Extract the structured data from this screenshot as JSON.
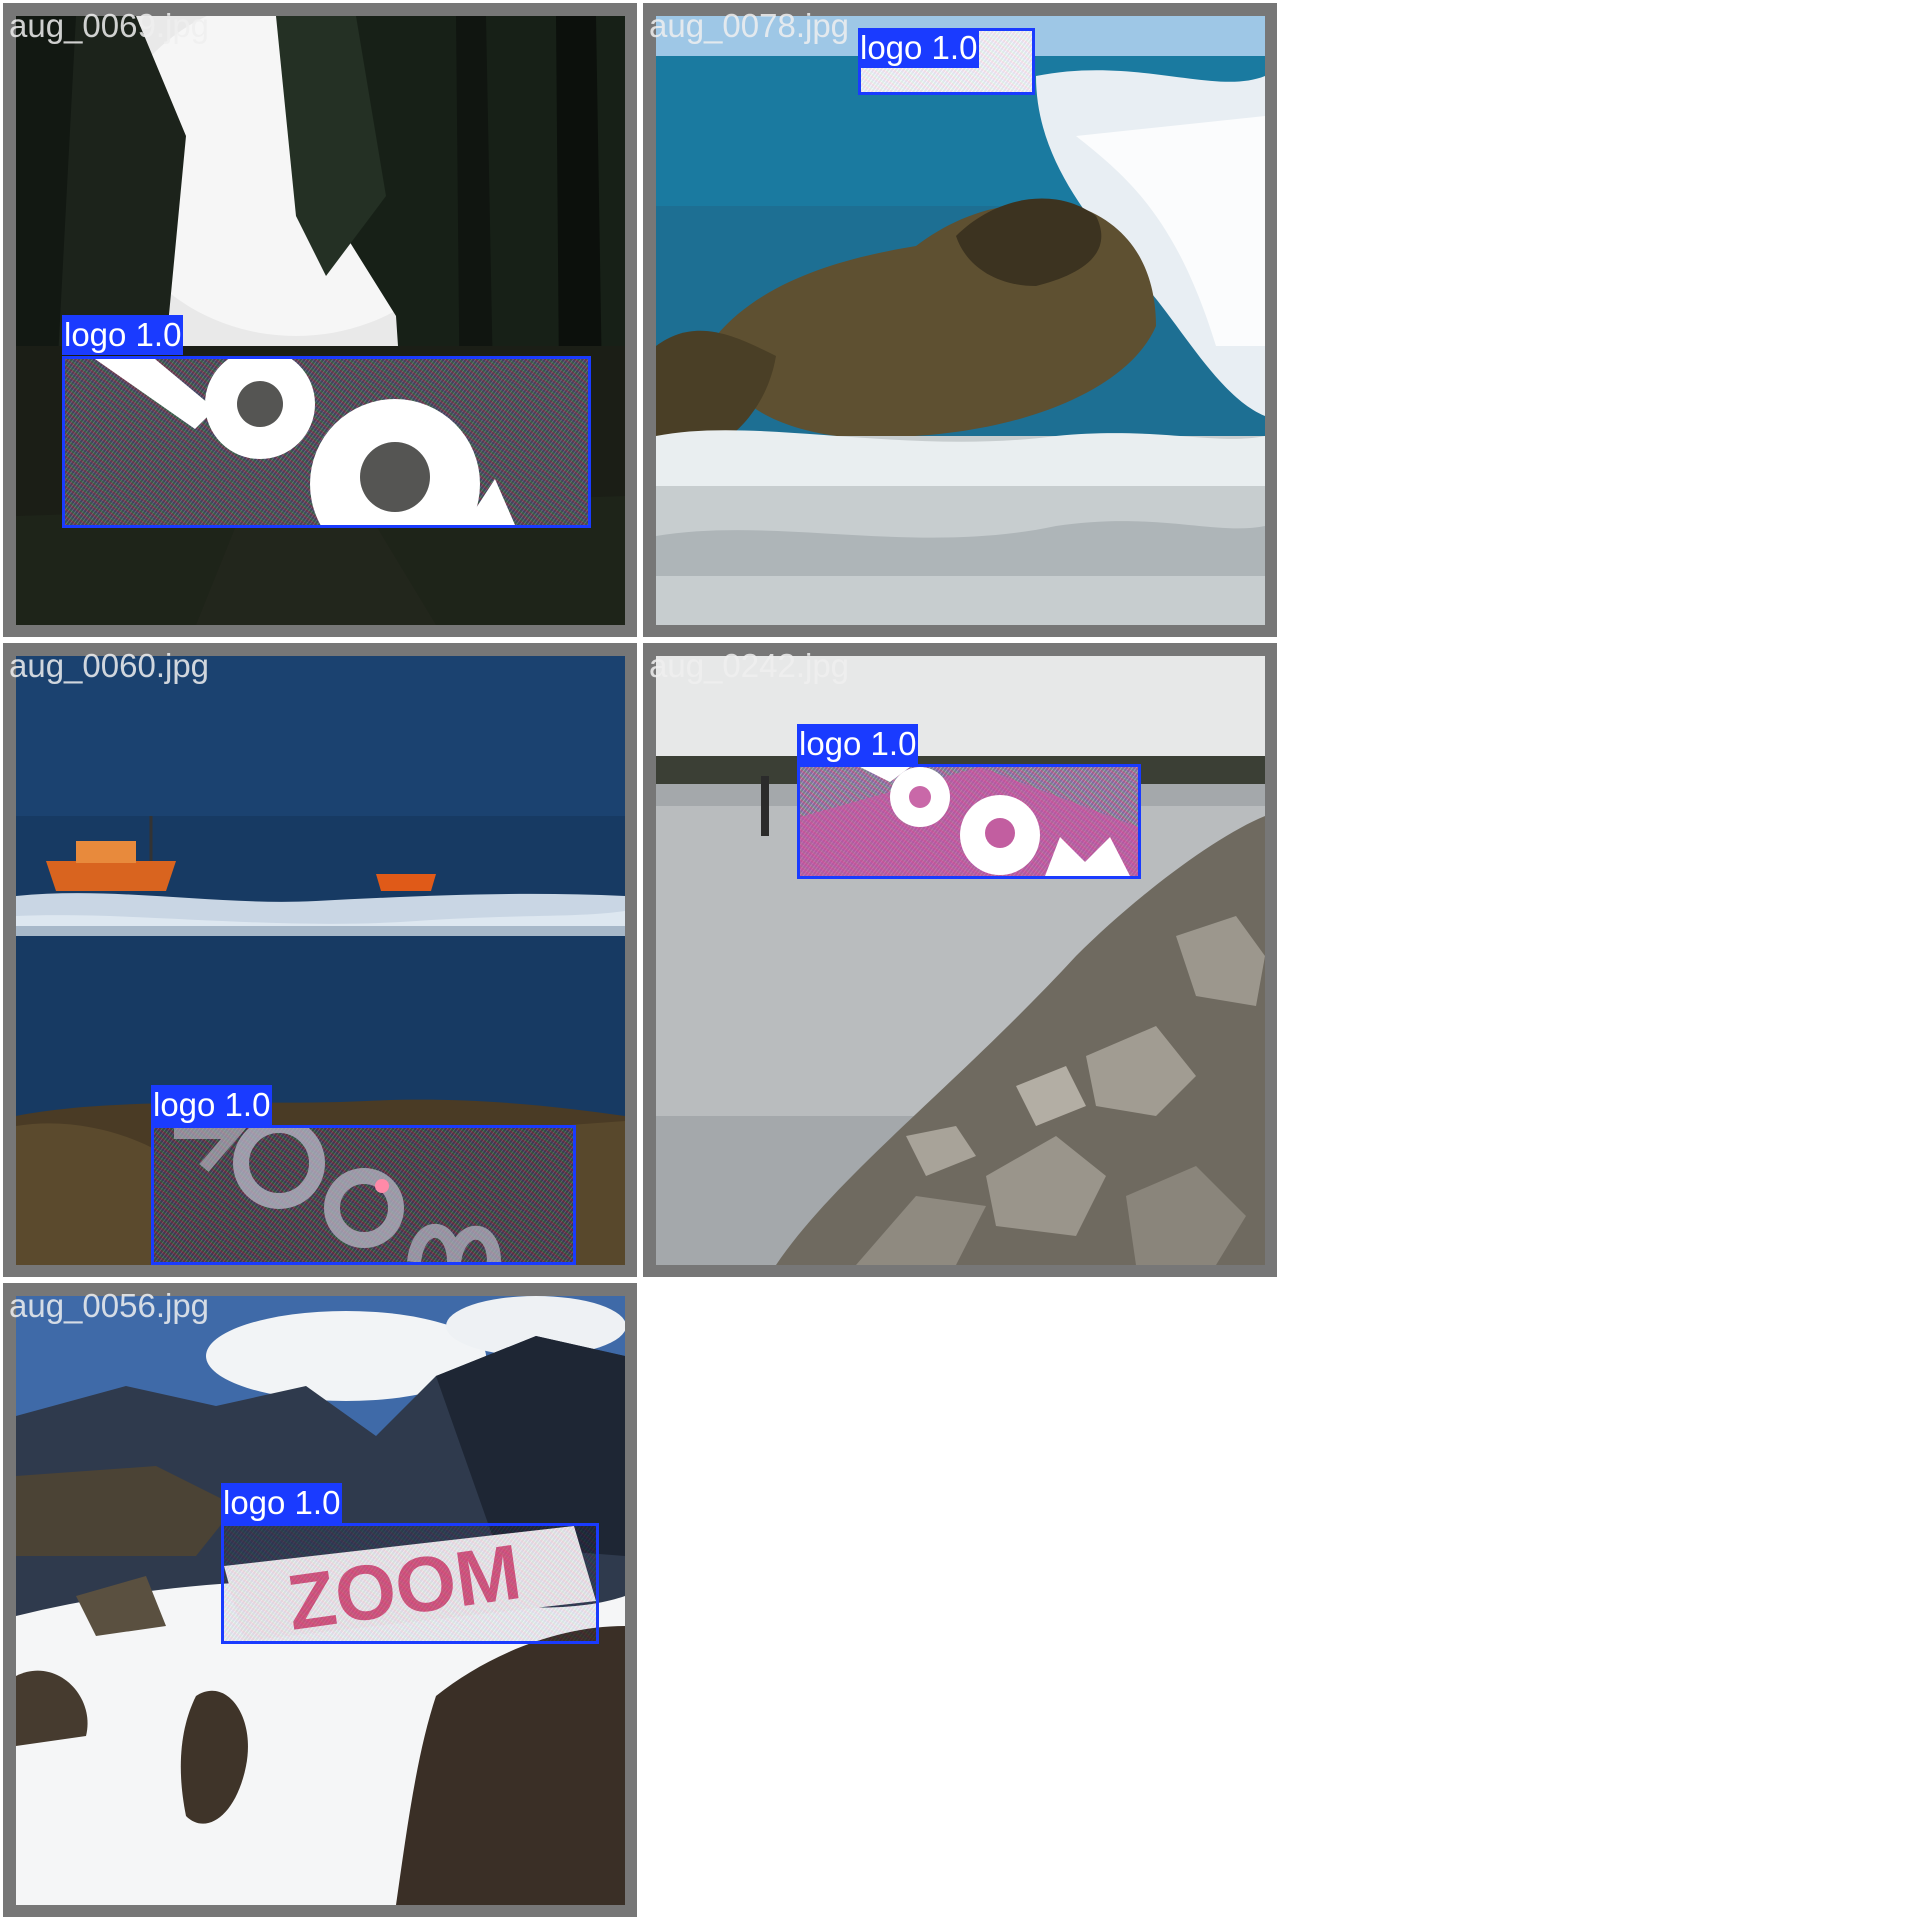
{
  "grid": {
    "tiles": [
      {
        "filename": "aug_0069.jpg",
        "scene": "forest-path",
        "detection": {
          "label": "logo 1.0",
          "class": "logo",
          "confidence": 1.0
        },
        "logo_text": "ZOO"
      },
      {
        "filename": "aug_0078.jpg",
        "scene": "ocean-wave-rocks",
        "detection": {
          "label": "logo 1.0",
          "class": "logo",
          "confidence": 1.0
        }
      },
      {
        "filename": "aug_0060.jpg",
        "scene": "sea-with-boats",
        "detection": {
          "label": "logo 1.0",
          "class": "logo",
          "confidence": 1.0
        },
        "logo_text": "ZOOM"
      },
      {
        "filename": "aug_0242.jpg",
        "scene": "lake-rocky-shore",
        "detection": {
          "label": "logo 1.0",
          "class": "logo",
          "confidence": 1.0
        },
        "logo_text": "ZOOM"
      },
      {
        "filename": "aug_0056.jpg",
        "scene": "snowy-mountains",
        "detection": {
          "label": "logo 1.0",
          "class": "logo",
          "confidence": 1.0
        },
        "logo_text": "ZOOM"
      }
    ]
  },
  "colors": {
    "bbox": "#1a3bff",
    "tile_border": "#777777",
    "background": "#ffffff"
  }
}
